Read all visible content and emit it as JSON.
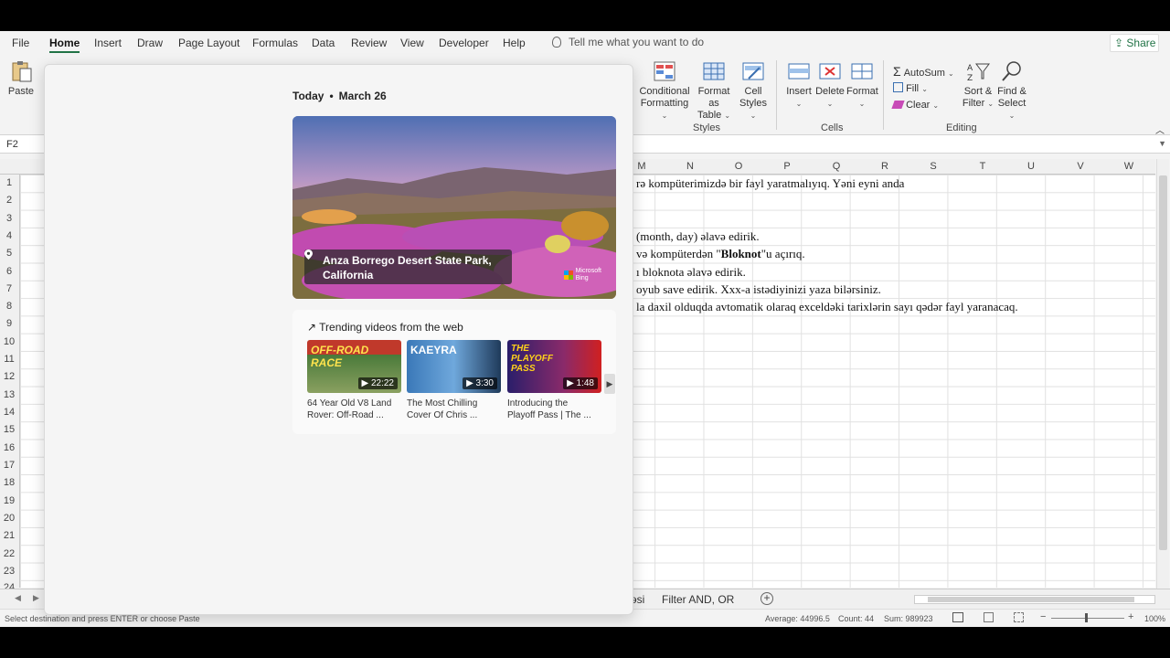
{
  "menu": {
    "tabs": [
      "File",
      "Home",
      "Insert",
      "Draw",
      "Page Layout",
      "Formulas",
      "Data",
      "Review",
      "View",
      "Developer",
      "Help"
    ],
    "active": "Home",
    "tellme": "Tell me what you want to do",
    "share": "Share"
  },
  "ribbon": {
    "paste": "Paste",
    "conditional": "Conditional",
    "formatting": "Formatting",
    "format_as": "Format as",
    "table": "Table",
    "cell": "Cell",
    "styles_btn": "Styles",
    "insert": "Insert",
    "delete": "Delete",
    "format": "Format",
    "autosum": "AutoSum",
    "fill": "Fill",
    "clear": "Clear",
    "sort": "Sort &",
    "filter": "Filter",
    "find": "Find &",
    "select": "Select",
    "group_styles": "Styles",
    "group_cells": "Cells",
    "group_editing": "Editing"
  },
  "namebox": "F2",
  "columns": [
    "M",
    "N",
    "O",
    "P",
    "Q",
    "R",
    "S",
    "T",
    "U",
    "V",
    "W"
  ],
  "rows": [
    "1",
    "2",
    "3",
    "4",
    "5",
    "6",
    "7",
    "8",
    "9",
    "10",
    "11",
    "12",
    "13",
    "14",
    "15",
    "16",
    "17",
    "18",
    "19",
    "20",
    "21",
    "22",
    "23",
    "24"
  ],
  "cells": {
    "r1": "rə kompüterimizdə bir fayl yaratmalıyıq. Yəni eyni anda",
    "r4": "(month, day) əlavə edirik.",
    "r5a": "və kompüterdən \"",
    "r5b": "Bloknot",
    "r5c": "\"u açırıq.",
    "r6": "ı bloknota əlavə edirik.",
    "r7": "oyub save edirik. Xxx-a istədiyinizi yaza bilərsiniz.",
    "r8": "la daxil olduqda avtomatik olaraq exceldəki tarixlərin sayı qədər fayl yaranacaq."
  },
  "sheets": {
    "partial": "əsi",
    "tab2": "Filter AND, OR"
  },
  "status": {
    "message": "Select destination and press ENTER or choose Paste",
    "average": "Average: 44996.5",
    "count": "Count: 44",
    "sum": "Sum: 989923",
    "zoom": "100%"
  },
  "widget": {
    "today": "Today",
    "date": "March 26",
    "location_line1": "Anza Borrego Desert State Park,",
    "location_line2": "California",
    "ms_line1": "Microsoft",
    "ms_line2": "Bing",
    "trending": "Trending videos from the web",
    "videos": [
      {
        "label": "OFF-ROAD RACE",
        "duration": "22:22",
        "title1": "64 Year Old V8 Land",
        "title2": "Rover: Off-Road ..."
      },
      {
        "label": "KAEYRA",
        "duration": "3:30",
        "title1": "The Most Chilling",
        "title2": "Cover Of Chris ..."
      },
      {
        "label": "THE PLAYOFF PASS",
        "duration": "1:48",
        "title1": "Introducing the",
        "title2": "Playoff Pass | The ..."
      }
    ]
  }
}
